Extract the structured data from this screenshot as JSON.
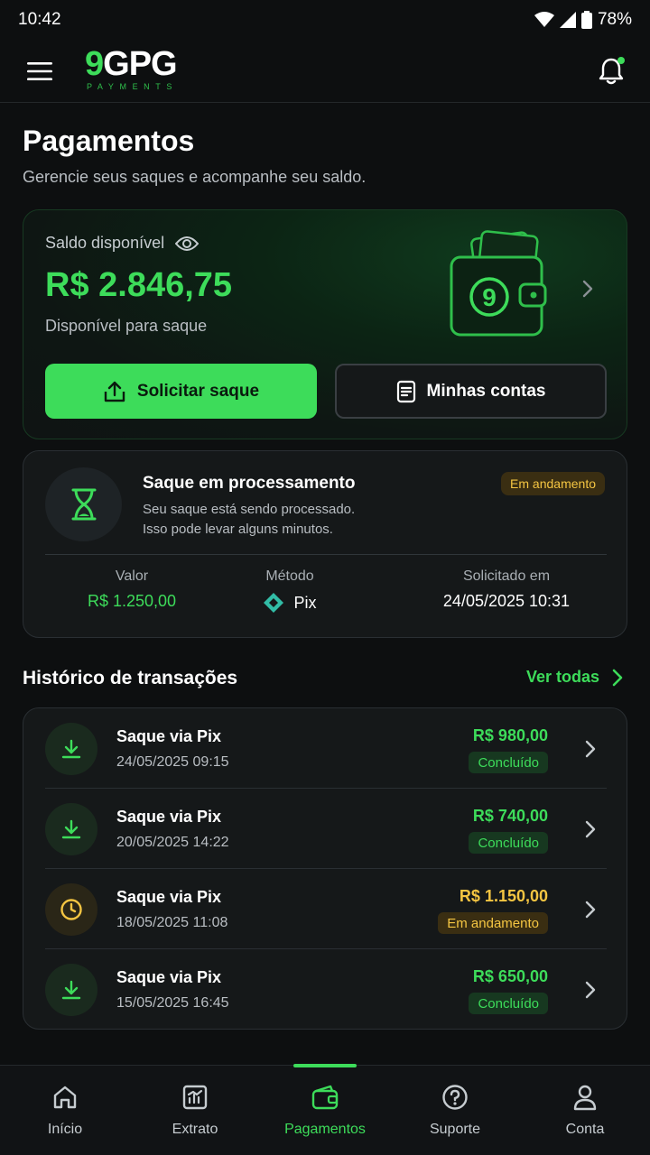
{
  "status_bar": {
    "time": "10:42",
    "battery": "78%"
  },
  "header": {
    "logo_main_number": "9",
    "logo_main_text": "GPG",
    "logo_sub": "PAYMENTS"
  },
  "page": {
    "title": "Pagamentos",
    "subtitle": "Gerencie seus saques e acompanhe seu saldo."
  },
  "balance": {
    "label": "Saldo disponível",
    "value": "R$ 2.846,75",
    "sub": "Disponível para saque",
    "wallet_badge": "9",
    "primary_btn": "Solicitar saque",
    "secondary_btn": "Minhas contas"
  },
  "processing": {
    "title": "Saque em processamento",
    "desc_line1": "Seu saque está sendo processado.",
    "desc_line2": "Isso pode levar alguns minutos.",
    "badge": "Em andamento",
    "valor_label": "Valor",
    "valor": "R$ 1.250,00",
    "metodo_label": "Método",
    "metodo": "Pix",
    "solicitado_label": "Solicitado em",
    "solicitado": "24/05/2025 10:31"
  },
  "history": {
    "title": "Histórico de transações",
    "see_all": "Ver todas",
    "items": [
      {
        "name": "Saque via Pix",
        "date": "24/05/2025 09:15",
        "amount": "R$ 980,00",
        "status": "Concluído"
      },
      {
        "name": "Saque via Pix",
        "date": "20/05/2025 14:22",
        "amount": "R$ 740,00",
        "status": "Concluído"
      },
      {
        "name": "Saque via Pix",
        "date": "18/05/2025 11:08",
        "amount": "R$ 1.150,00",
        "status": "Em andamento"
      },
      {
        "name": "Saque via Pix",
        "date": "15/05/2025 16:45",
        "amount": "R$ 650,00",
        "status": "Concluído"
      }
    ]
  },
  "nav": {
    "items": [
      {
        "label": "Início"
      },
      {
        "label": "Extrato"
      },
      {
        "label": "Pagamentos"
      },
      {
        "label": "Suporte"
      },
      {
        "label": "Conta"
      }
    ],
    "active": "Pagamentos"
  },
  "colors": {
    "accent": "#3ddc5a",
    "pending": "#f4c542",
    "background": "#0d0f10",
    "card": "#151819"
  }
}
